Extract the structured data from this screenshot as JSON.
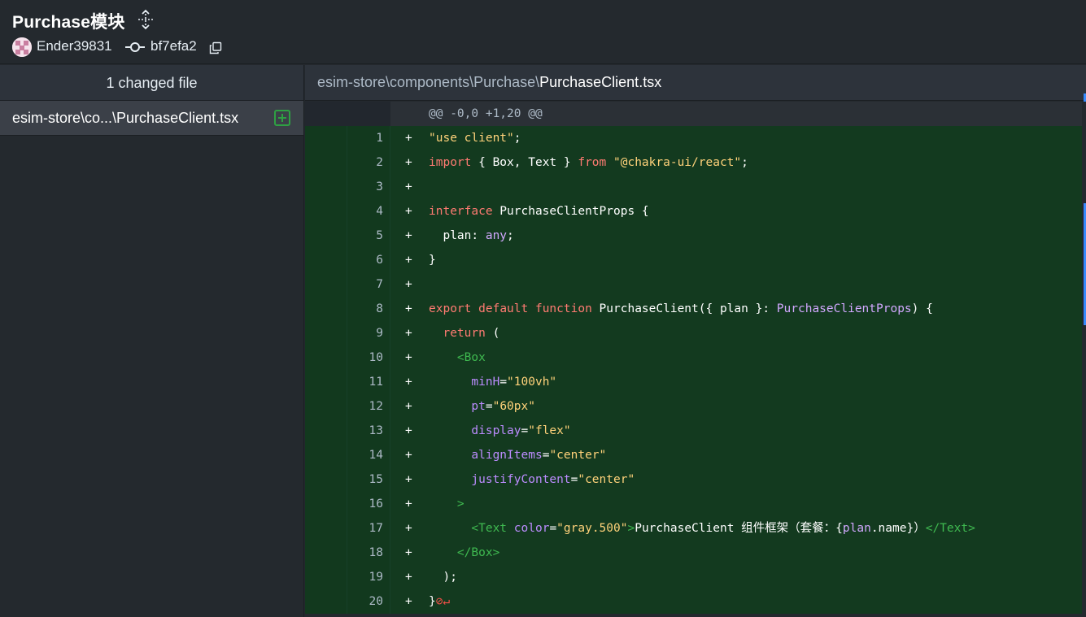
{
  "header": {
    "commit_title": "Purchase模块",
    "author": "Ender39831",
    "sha": "bf7efa2"
  },
  "sidebar": {
    "changed_count": "1 changed file",
    "files": [
      {
        "name": "esim-store\\co...\\PurchaseClient.tsx",
        "status": "added"
      }
    ]
  },
  "diff": {
    "path_dir": "esim-store\\components\\Purchase\\",
    "path_file": "PurchaseClient.tsx",
    "hunk_header": "@@ -0,0 +1,20 @@",
    "marker": "+",
    "lines": [
      {
        "n": "1",
        "segments": [
          [
            "str",
            "\"use client\""
          ],
          [
            "",
            ";"
          ]
        ]
      },
      {
        "n": "2",
        "segments": [
          [
            "kw",
            "import"
          ],
          [
            "",
            " { Box, Text } "
          ],
          [
            "kw",
            "from"
          ],
          [
            "",
            " "
          ],
          [
            "str",
            "\"@chakra-ui/react\""
          ],
          [
            "",
            ";"
          ]
        ]
      },
      {
        "n": "3",
        "segments": []
      },
      {
        "n": "4",
        "segments": [
          [
            "kw",
            "interface"
          ],
          [
            "",
            " PurchaseClientProps {"
          ]
        ]
      },
      {
        "n": "5",
        "segments": [
          [
            "",
            "  plan: "
          ],
          [
            "tp",
            "any"
          ],
          [
            "",
            ";"
          ]
        ]
      },
      {
        "n": "6",
        "segments": [
          [
            "",
            "}"
          ]
        ]
      },
      {
        "n": "7",
        "segments": []
      },
      {
        "n": "8",
        "segments": [
          [
            "kw",
            "export"
          ],
          [
            "",
            " "
          ],
          [
            "kw",
            "default"
          ],
          [
            "",
            " "
          ],
          [
            "kw",
            "function"
          ],
          [
            "",
            " PurchaseClient({ plan }: "
          ],
          [
            "tp",
            "PurchaseClientProps"
          ],
          [
            "",
            ") {"
          ]
        ]
      },
      {
        "n": "9",
        "segments": [
          [
            "",
            "  "
          ],
          [
            "kw",
            "return"
          ],
          [
            "",
            " ("
          ]
        ]
      },
      {
        "n": "10",
        "segments": [
          [
            "",
            "    "
          ],
          [
            "tag",
            "<Box"
          ]
        ]
      },
      {
        "n": "11",
        "segments": [
          [
            "",
            "      "
          ],
          [
            "attr",
            "minH"
          ],
          [
            "",
            "="
          ],
          [
            "str",
            "\"100vh\""
          ]
        ]
      },
      {
        "n": "12",
        "segments": [
          [
            "",
            "      "
          ],
          [
            "attr",
            "pt"
          ],
          [
            "",
            "="
          ],
          [
            "str",
            "\"60px\""
          ]
        ]
      },
      {
        "n": "13",
        "segments": [
          [
            "",
            "      "
          ],
          [
            "attr",
            "display"
          ],
          [
            "",
            "="
          ],
          [
            "str",
            "\"flex\""
          ]
        ]
      },
      {
        "n": "14",
        "segments": [
          [
            "",
            "      "
          ],
          [
            "attr",
            "alignItems"
          ],
          [
            "",
            "="
          ],
          [
            "str",
            "\"center\""
          ]
        ]
      },
      {
        "n": "15",
        "segments": [
          [
            "",
            "      "
          ],
          [
            "attr",
            "justifyContent"
          ],
          [
            "",
            "="
          ],
          [
            "str",
            "\"center\""
          ]
        ]
      },
      {
        "n": "16",
        "segments": [
          [
            "",
            "    "
          ],
          [
            "tag",
            ">"
          ]
        ]
      },
      {
        "n": "17",
        "segments": [
          [
            "",
            "      "
          ],
          [
            "tag",
            "<Text"
          ],
          [
            "",
            " "
          ],
          [
            "attr",
            "color"
          ],
          [
            "",
            "="
          ],
          [
            "str",
            "\"gray.500\""
          ],
          [
            "tag",
            ">"
          ],
          [
            "",
            "PurchaseClient 组件框架（套餐：{"
          ],
          [
            "var",
            "plan"
          ],
          [
            "",
            ".name}）"
          ],
          [
            "tag",
            "</Text>"
          ]
        ]
      },
      {
        "n": "18",
        "segments": [
          [
            "",
            "    "
          ],
          [
            "tag",
            "</Box>"
          ]
        ]
      },
      {
        "n": "19",
        "segments": [
          [
            "",
            "  );"
          ]
        ]
      },
      {
        "n": "20",
        "segments": [
          [
            "",
            "}"
          ],
          [
            "nl",
            "⊘↵"
          ]
        ]
      }
    ]
  }
}
